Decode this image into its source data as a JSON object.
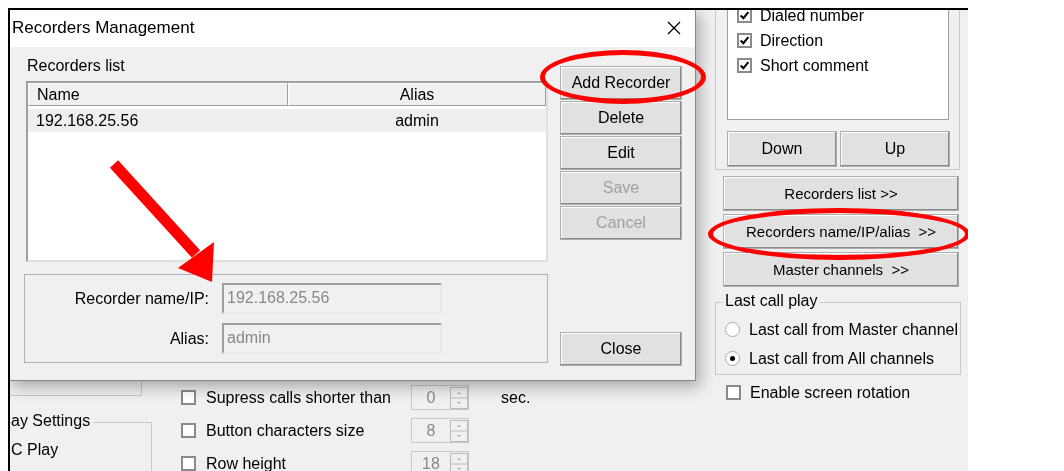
{
  "dialog": {
    "title": "Recorders Management",
    "list_label": "Recorders list",
    "columns": [
      "Name",
      "Alias"
    ],
    "rows": [
      {
        "name": "192.168.25.56",
        "alias": "admin",
        "selected": true
      }
    ],
    "buttons": [
      {
        "label": "Add Recorder",
        "disabled": false,
        "circled": true
      },
      {
        "label": "Delete",
        "disabled": false,
        "circled": false
      },
      {
        "label": "Edit",
        "disabled": false,
        "circled": false
      },
      {
        "label": "Save",
        "disabled": true,
        "circled": false
      },
      {
        "label": "Cancel",
        "disabled": true,
        "circled": false
      }
    ],
    "field_panel": {
      "arrow": true,
      "fields": [
        {
          "label": "Recorder name/IP:",
          "value": "192.168.25.56",
          "disabled": true
        },
        {
          "label": "Alias:",
          "value": "admin",
          "disabled": true
        }
      ]
    },
    "close_button": "Close"
  },
  "background": {
    "columns_list": [
      {
        "label": "Dialed number",
        "checked": true
      },
      {
        "label": "Direction",
        "checked": true
      },
      {
        "label": "Short comment",
        "checked": true
      }
    ],
    "order_buttons": [
      "Down",
      "Up"
    ],
    "nav_buttons": [
      {
        "label": "Recorders list >>",
        "circled": false
      },
      {
        "label": "Recorders name/IP/alias  >>",
        "circled": true
      },
      {
        "label": "Master channels  >>",
        "circled": false
      }
    ],
    "last_call_play": {
      "title": "Last call play",
      "options": [
        {
          "label": "Last call from Master channel",
          "selected": false
        },
        {
          "label": "Last call from All channels",
          "selected": true
        }
      ]
    },
    "screen_rotation": {
      "label": "Enable screen rotation",
      "checked": false
    },
    "options": [
      {
        "label": "Supress calls shorter than",
        "checked": false,
        "value": "0",
        "unit": "sec."
      },
      {
        "label": "Button characters size",
        "checked": false,
        "value": "8"
      },
      {
        "label": "Row height",
        "checked": false,
        "value": "18"
      }
    ],
    "display_group": {
      "title": "ay Settings",
      "item": "C Play"
    }
  }
}
